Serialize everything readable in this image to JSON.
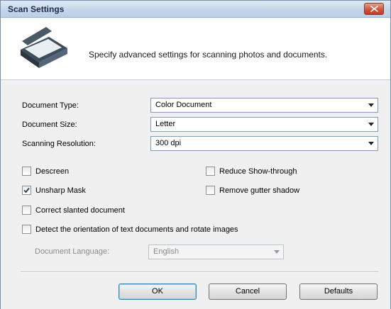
{
  "window": {
    "title": "Scan Settings"
  },
  "header": {
    "description": "Specify advanced settings for scanning photos and documents."
  },
  "fields": {
    "document_type": {
      "label": "Document Type:",
      "value": "Color Document"
    },
    "document_size": {
      "label": "Document Size:",
      "value": "Letter"
    },
    "scanning_resolution": {
      "label": "Scanning Resolution:",
      "value": "300 dpi"
    },
    "document_language": {
      "label": "Document Language:",
      "value": "English"
    }
  },
  "options": {
    "descreen": {
      "label": "Descreen",
      "checked": false
    },
    "unsharp_mask": {
      "label": "Unsharp Mask",
      "checked": true
    },
    "correct_slanted": {
      "label": "Correct slanted document",
      "checked": false
    },
    "detect_orientation": {
      "label": "Detect the orientation of text documents and rotate images",
      "checked": false
    },
    "reduce_show_through": {
      "label": "Reduce Show-through",
      "checked": false
    },
    "remove_gutter_shadow": {
      "label": "Remove gutter shadow",
      "checked": false
    }
  },
  "buttons": {
    "ok": "OK",
    "cancel": "Cancel",
    "defaults": "Defaults"
  },
  "icons": {
    "close": "close-icon",
    "scanner": "scanner-icon",
    "check": "checkmark-icon",
    "dropdown": "chevron-down-icon"
  },
  "colors": {
    "title_bar": "#c4d5ea",
    "close_button": "#d0543c",
    "field_border": "#7f9db9",
    "default_button_border": "#3c7fb1"
  }
}
